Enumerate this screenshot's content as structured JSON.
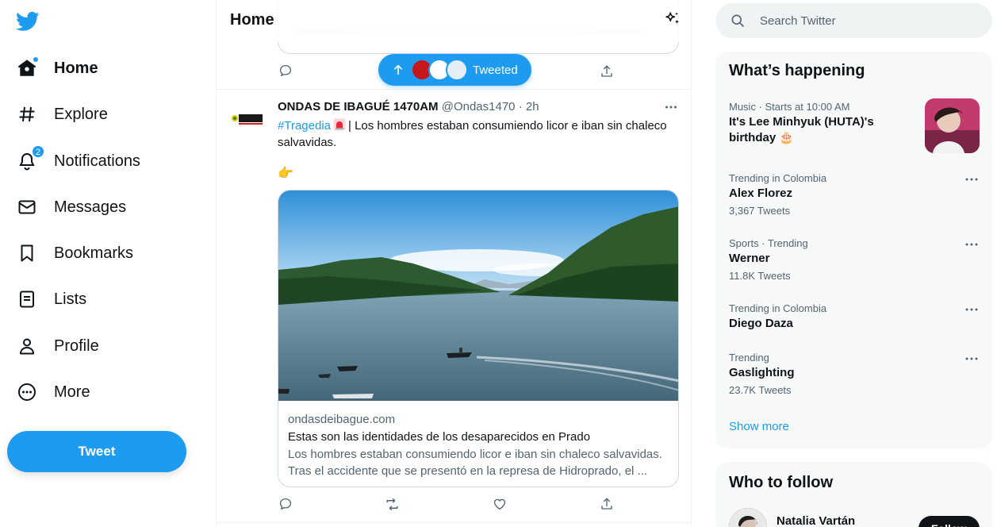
{
  "sidebar": {
    "items": [
      {
        "label": "Home",
        "icon": "home-icon"
      },
      {
        "label": "Explore",
        "icon": "hashtag-icon"
      },
      {
        "label": "Notifications",
        "icon": "bell-icon",
        "badge": "2"
      },
      {
        "label": "Messages",
        "icon": "envelope-icon"
      },
      {
        "label": "Bookmarks",
        "icon": "bookmark-icon"
      },
      {
        "label": "Lists",
        "icon": "list-icon"
      },
      {
        "label": "Profile",
        "icon": "person-icon"
      },
      {
        "label": "More",
        "icon": "more-circle-icon"
      }
    ],
    "tweet_button": "Tweet"
  },
  "main": {
    "title": "Home",
    "new_tweets_pill": {
      "label": "Tweeted"
    },
    "tweet": {
      "author_name": "ONDAS DE IBAGUÉ 1470AM",
      "handle": "@Ondas1470",
      "separator": "·",
      "time": "2h",
      "hashtag": "#Tragedia",
      "text_after": "| Los hombres estaban consumiendo licor e iban sin chaleco salvavidas.",
      "pointer_emoji": "👉",
      "card": {
        "domain": "ondasdeibague.com",
        "title": "Estas son las identidades de los desaparecidos en Prado",
        "description": "Los hombres estaban consumiendo licor e iban sin chaleco salvavidas. Tras el accidente que se presentó en la represa de Hidroprado, el ..."
      }
    }
  },
  "right": {
    "search": {
      "placeholder": "Search Twitter"
    },
    "happening": {
      "title": "What’s happening",
      "trends": [
        {
          "meta": "Music · Starts at 10:00 AM",
          "name": "It's Lee Minhyuk (HUTA)'s birthday 🎂",
          "count": ""
        },
        {
          "meta": "Trending in Colombia",
          "name": "Alex Florez",
          "count": "3,367 Tweets"
        },
        {
          "meta": "Sports · Trending",
          "name": "Werner",
          "count": "11.8K Tweets"
        },
        {
          "meta": "Trending in Colombia",
          "name": "Diego Daza",
          "count": ""
        },
        {
          "meta": "Trending",
          "name": "Gaslighting",
          "count": "23.7K Tweets"
        }
      ],
      "show_more": "Show more"
    },
    "who_to_follow": {
      "title": "Who to follow",
      "user_name": "Natalia Vartán",
      "follow_label": "Follow"
    }
  },
  "colors": {
    "accent": "#1d9bf0",
    "text": "#0f1419",
    "muted": "#536471",
    "panel": "#f7f9f9"
  }
}
